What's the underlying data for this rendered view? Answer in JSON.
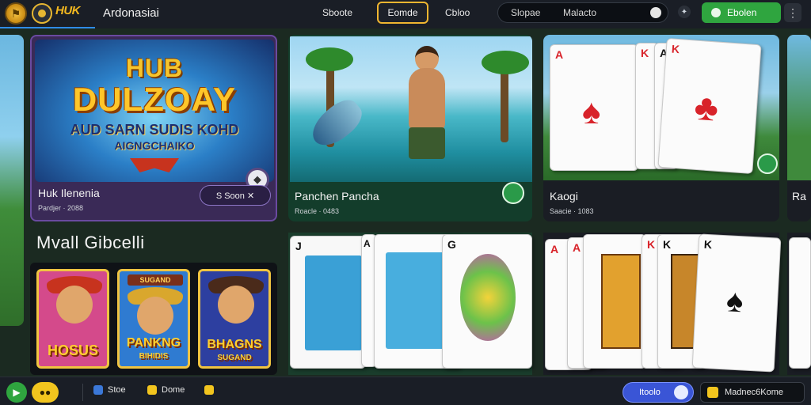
{
  "header": {
    "brand_mark": "HUK",
    "brand_name": "Ardonasiai",
    "nav": [
      "Sboote",
      "Eomde",
      "Cbloo"
    ],
    "active_nav": "Eomde",
    "search_left": "Slopae",
    "search_right": "Malacto",
    "login_label": "Ebolen",
    "kebab": "⋮"
  },
  "featured": {
    "art_line1": "HUB",
    "art_line2": "DULZOAY",
    "art_line3": "AUD SARN SUDIS KOHD",
    "art_line4": "AIGNGCHAIKO",
    "name": "Huk Ilenenia",
    "sub": "Pardjer · 2088",
    "play_label": "S Soon ✕"
  },
  "games": [
    {
      "name": "Panchen Pancha",
      "sub": "Roacle · 0483"
    },
    {
      "name": "Kaogi",
      "sub": "Saacie · 1083"
    },
    {
      "name": "Ra",
      "sub": ""
    }
  ],
  "section": {
    "title": "Mvall Gibcelli"
  },
  "slots": [
    {
      "top": "",
      "label": "HOSUS",
      "hat_color": "#c7331e",
      "bg": "#d44a8b"
    },
    {
      "top": "SUGAND",
      "label": "PANKNG",
      "sub": "BIHIDIS",
      "hat_color": "#d9a72d",
      "bg": "#2f7bd1"
    },
    {
      "top": "",
      "label": "BHAGNS",
      "sub": "SUGAND",
      "hat_color": "#4a2a1a",
      "bg": "#2d3fa0"
    }
  ],
  "card_ranks": {
    "featured": [
      "A",
      "K",
      "A",
      "K"
    ],
    "fish_row": [
      "J",
      "A",
      "G"
    ],
    "card_row": [
      "A",
      "A",
      "K",
      "K",
      "K"
    ]
  },
  "bottombar": {
    "items": [
      "Stoe",
      "Dome"
    ],
    "blue_label": "Itoolo",
    "account_label": "Madnec6Kome"
  },
  "colors": {
    "accent_gold": "#f0b630",
    "green": "#2fa53f",
    "blue": "#3a55d6"
  }
}
